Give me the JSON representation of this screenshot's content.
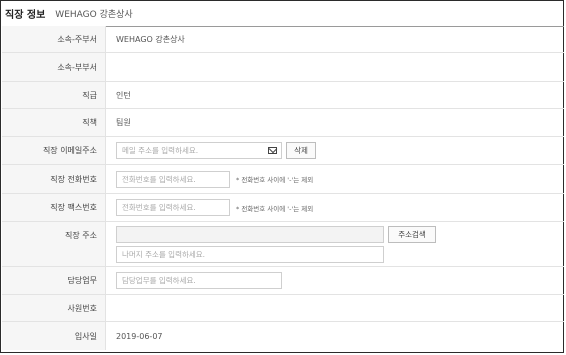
{
  "header": {
    "title": "직장 정보",
    "company": "WEHAGO 강촌상사"
  },
  "fields": {
    "affiliation_main": {
      "label": "소속-주부서",
      "value": "WEHAGO 강촌상사"
    },
    "affiliation_sub": {
      "label": "소속-부부서",
      "value": ""
    },
    "rank": {
      "label": "직급",
      "value": "인턴"
    },
    "position": {
      "label": "직책",
      "value": "팀원"
    },
    "email": {
      "label": "직장 이메일주소",
      "placeholder": "메일 주소를 입력하세요.",
      "delete_button": "삭제",
      "icon": "mail-icon"
    },
    "phone": {
      "label": "직장 전화번호",
      "placeholder": "전화번호를 입력하세요.",
      "hint": "* 전화번호 사이에 '-'는 제외"
    },
    "fax": {
      "label": "직장 팩스번호",
      "placeholder": "전화번호를 입력하세요.",
      "hint": "* 전화번호 사이에 '-'는 제외"
    },
    "address": {
      "label": "직장 주소",
      "address_placeholder": "",
      "search_button": "주소검색",
      "detail_placeholder": "나머지 주소를 입력하세요."
    },
    "duty": {
      "label": "담당업무",
      "placeholder": "담당업무를 입력하세요."
    },
    "employee_no": {
      "label": "사원번호",
      "value": ""
    },
    "hire_date": {
      "label": "입사일",
      "value": "2019-06-07"
    }
  }
}
